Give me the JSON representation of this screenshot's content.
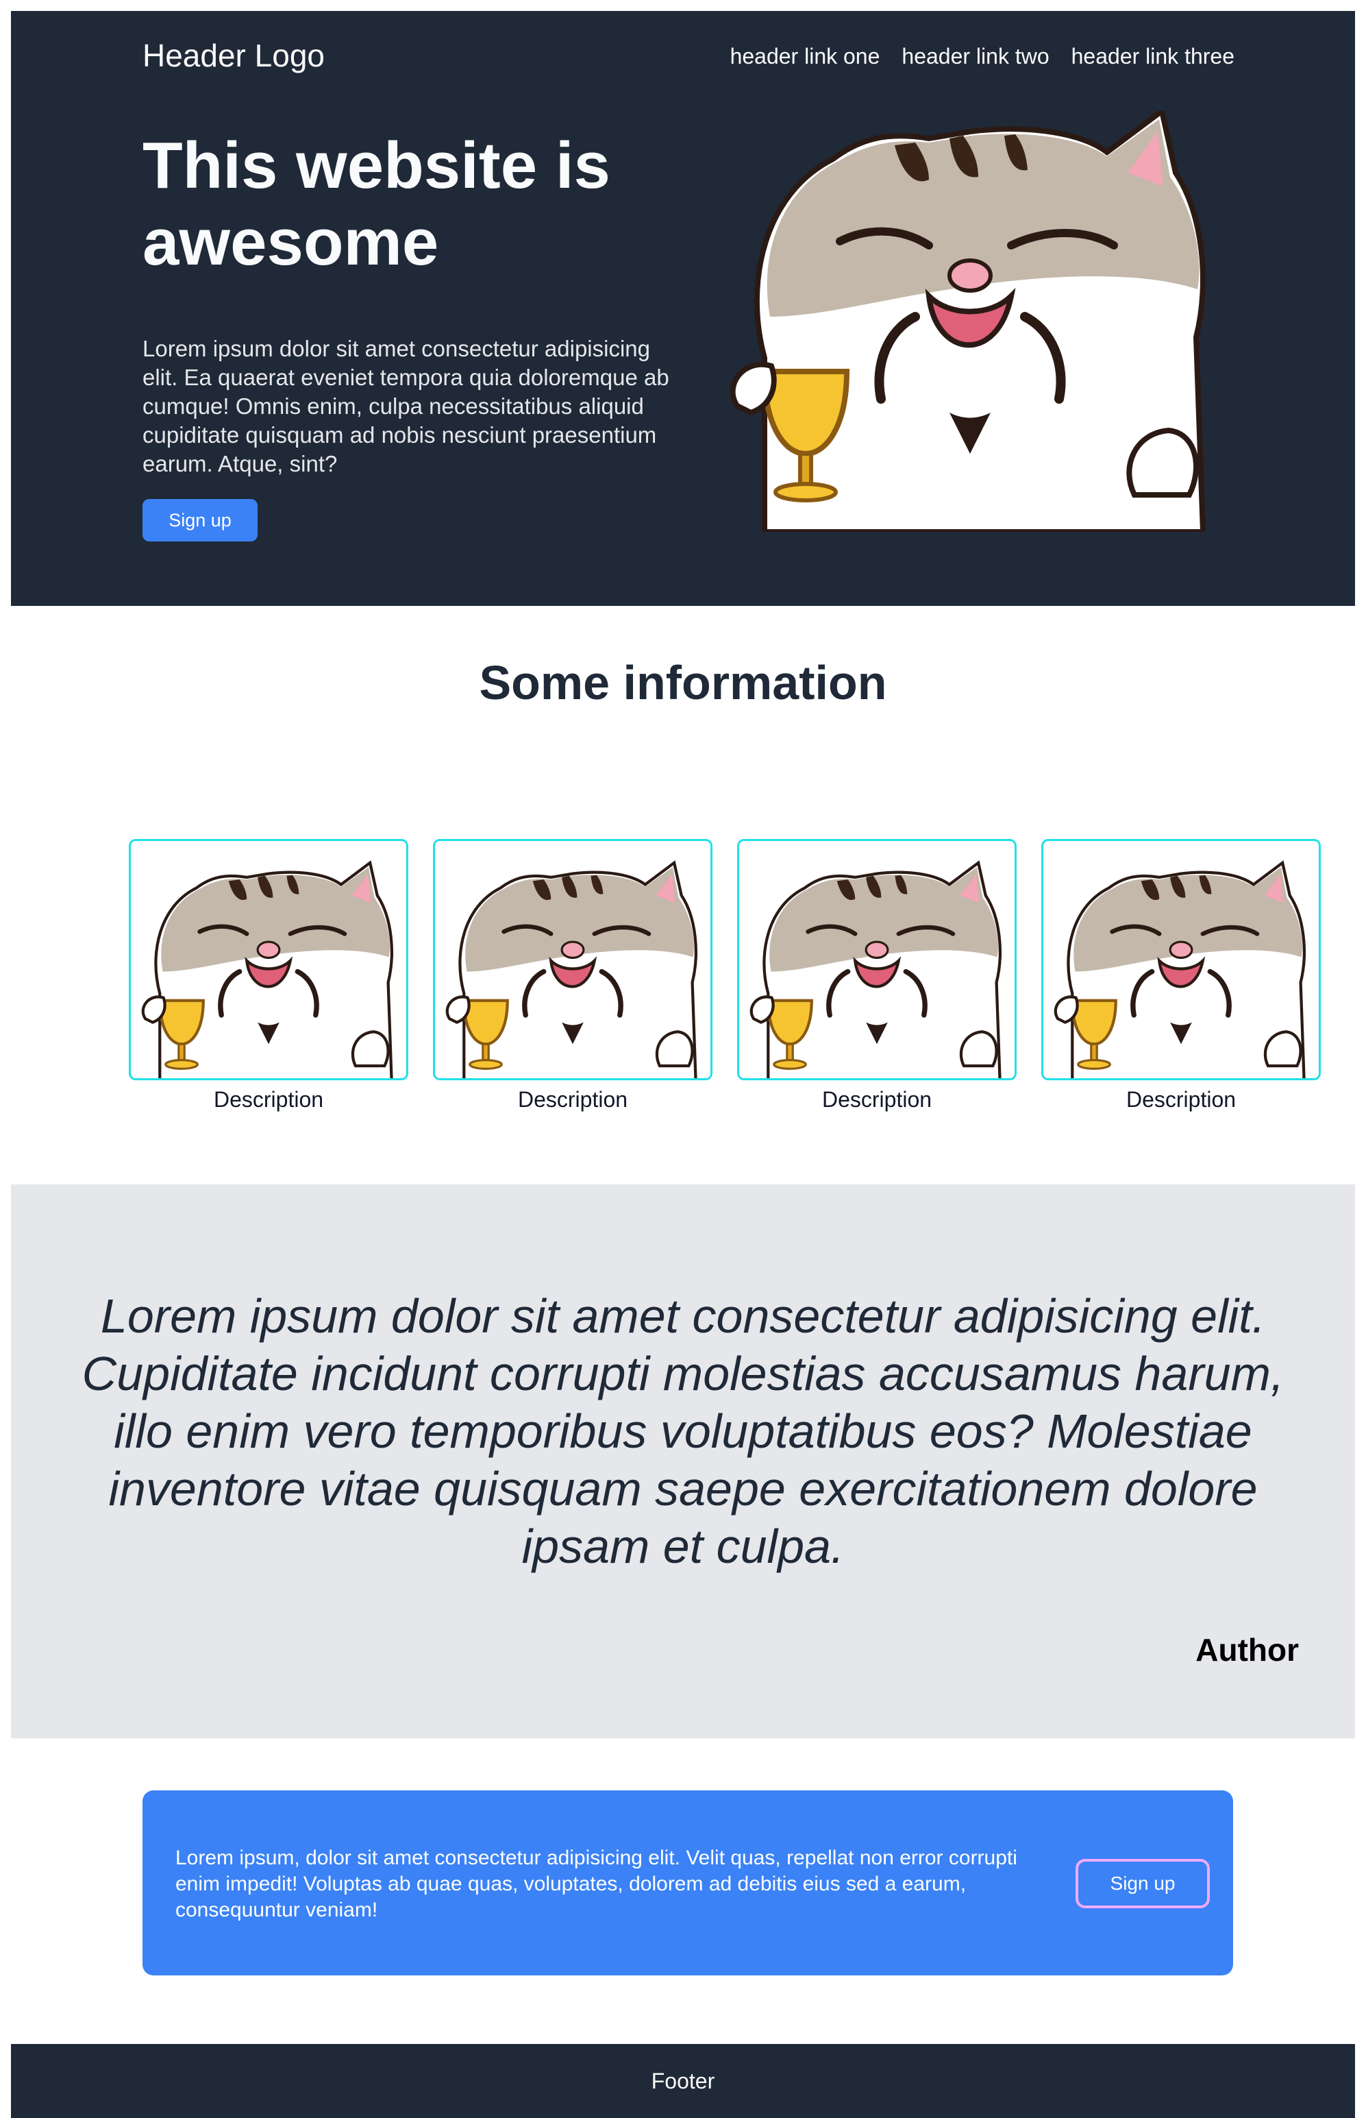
{
  "header": {
    "logo": "Header Logo",
    "nav": [
      "header link one",
      "header link two",
      "header link three"
    ]
  },
  "hero": {
    "title": "This website is awesome",
    "text": "Lorem ipsum dolor sit amet consectetur adipisicing elit. Ea quaerat eveniet tempora quia doloremque ab cumque! Omnis enim, culpa necessitatibus aliquid cupiditate quisquam ad nobis nesciunt praesentium earum. Atque, sint?",
    "button": "Sign up",
    "image_icon": "cat-sticker-image"
  },
  "info": {
    "title": "Some information",
    "cards": [
      {
        "description": "Description"
      },
      {
        "description": "Description"
      },
      {
        "description": "Description"
      },
      {
        "description": "Description"
      }
    ]
  },
  "quote": {
    "text": "Lorem ipsum dolor sit amet consectetur adipisicing elit. Cupiditate incidunt corrupti molestias accusamus harum, illo enim vero temporibus voluptatibus eos? Molestiae inventore vitae quisquam saepe exercitationem dolore ipsam et culpa.",
    "author": "Author"
  },
  "cta": {
    "text": "Lorem ipsum, dolor sit amet consectetur adipisicing elit. Velit quas, repellat non error corrupti enim impedit! Voluptas ab quae quas, voluptates, dolorem ad debitis eius sed a earum, consequuntur veniam!",
    "button": "Sign up"
  },
  "footer": {
    "text": "Footer"
  },
  "colors": {
    "dark": "#1f2937",
    "accent": "#3b82f6",
    "card_border": "#22e0e8",
    "quote_bg": "#e5e7eb",
    "cta_button_border": "#f0abfc"
  }
}
